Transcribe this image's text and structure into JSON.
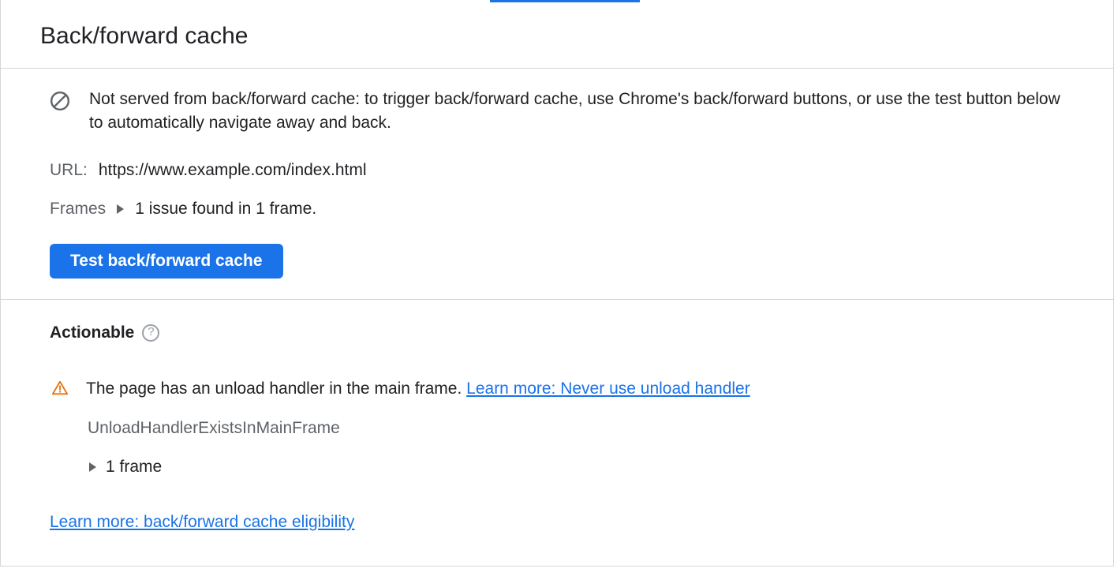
{
  "header": {
    "title": "Back/forward cache"
  },
  "status": {
    "message": "Not served from back/forward cache: to trigger back/forward cache, use Chrome's back/forward buttons, or use the test button below to automatically navigate away and back."
  },
  "url": {
    "label": "URL:",
    "value": "https://www.example.com/index.html"
  },
  "frames": {
    "label": "Frames",
    "summary": "1 issue found in 1 frame."
  },
  "buttons": {
    "test": "Test back/forward cache"
  },
  "actionable": {
    "title": "Actionable",
    "issue_text": "The page has an unload handler in the main frame. ",
    "issue_link": "Learn more: Never use unload handler",
    "issue_code": "UnloadHandlerExistsInMainFrame",
    "frame_count": "1 frame"
  },
  "footer": {
    "eligibility_link": "Learn more: back/forward cache eligibility"
  }
}
